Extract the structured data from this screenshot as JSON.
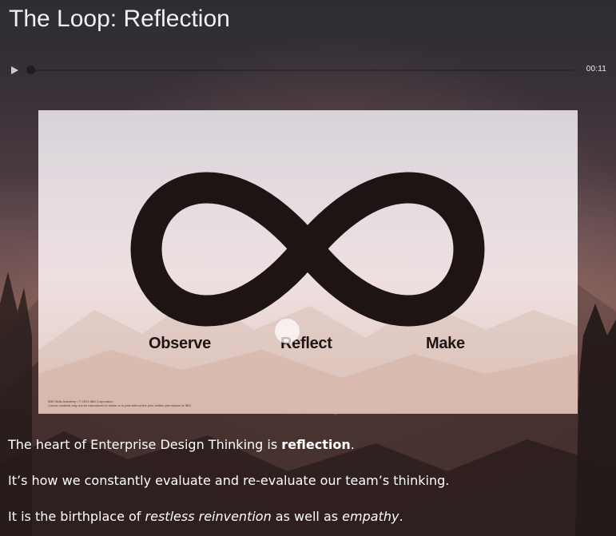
{
  "page": {
    "title": "The Loop: Reflection"
  },
  "audio": {
    "time": "00:11",
    "play_icon": "play-icon"
  },
  "slide": {
    "labels": {
      "observe": "Observe",
      "reflect": "Reflect",
      "make": "Make"
    },
    "footer_line1": "IBM Skills Academy / © 2021 IBM Corporation",
    "footer_line2": "Course material may not be reproduced in whole or in part without the prior written permission of IBM"
  },
  "content": {
    "p1_before": "The heart of Enterprise Design Thinking is ",
    "p1_bold": "reflection",
    "p1_after": ".",
    "p2": "It’s how we constantly evaluate and re-evaluate our team’s thinking.",
    "p3_before": "It is the birthplace of ",
    "p3_italic1": "restless reinvention",
    "p3_middle": " as well as ",
    "p3_italic2": "empathy",
    "p3_after": "."
  },
  "colors": {
    "background_top": "#2c2d33",
    "background_mid": "#7f5b56",
    "background_bottom": "#2e2120",
    "loop_color": "#1f1414",
    "slide_background": "#e6dde1",
    "text": "#ffffff"
  }
}
